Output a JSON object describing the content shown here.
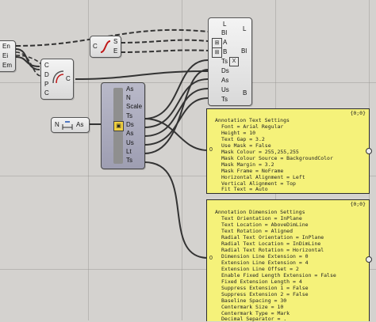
{
  "app": {
    "name": "Grasshopper canvas"
  },
  "nodes": {
    "left_param": {
      "outputs": [
        "En",
        "Ei",
        "Em"
      ]
    },
    "curve_comp": {
      "input": "C",
      "outputs": [
        "S",
        "E"
      ]
    },
    "arc_comp": {
      "inputs": [
        "C",
        "D",
        "P",
        "C"
      ],
      "output": "C"
    },
    "dim_comp": {
      "inputs": [
        "N",
        "As"
      ],
      "output": "As"
    },
    "deconstruct_comp": {
      "input": "As",
      "outputs": [
        "As",
        "N",
        "Scale",
        "Ts",
        "Ds",
        "As",
        "Us",
        "Lt",
        "Ts"
      ]
    },
    "text_comp": {
      "inputs": [
        "L",
        "Bl",
        "A",
        "B",
        "Ts",
        "Ds",
        "As",
        "Us",
        "Ts"
      ],
      "outputs": [
        "L",
        "Bl",
        "B"
      ],
      "x_label": "X"
    }
  },
  "panel_text": {
    "header": "{0;0}",
    "index": "0",
    "title": "Annotation Text Settings",
    "lines": [
      "Font = Arial Regular",
      "Height = 10",
      "Text Gap = 3.2",
      "Use Mask = False",
      "Mask Colour = 255,255,255",
      "Mask Colour Source = BackgroundColor",
      "Mask Margin = 3.2",
      "Mask Frame = NoFrame",
      "Horizontal Alignment = Left",
      "Vertical Alignment = Top",
      "Fit Text = Auto"
    ]
  },
  "panel_dim": {
    "header": "{0;0}",
    "index": "0",
    "title": "Annotation Dimension Settings",
    "lines": [
      "Text Orientation = InPlane",
      "Text Location = AboveDimLine",
      "Text Rotation = Aligned",
      "Radial Text Orientation = InPlane",
      "Radial Text Location = InDimLine",
      "Radial Text Rotation = Horizontal",
      "Dimension Line Extension = 0",
      "Extension Line Extension = 4",
      "Extension Line Offset = 2",
      "Enable Fixed Length Extension = False",
      "Fixed Extension Length = 4",
      "Suppress Extension 1 = False",
      "Suppress Extension 2 = False",
      "Baseline Spacing = 30",
      "Centermark Size = 10",
      "Centermark Type = Mark",
      "Decimal Separator = ."
    ]
  },
  "colors": {
    "canvas": "#d4d2cf",
    "panel": "#f5f27a",
    "wire": "#3a3a3a",
    "component": "#e8e8e8",
    "selected_component": "#a8a8bc"
  }
}
